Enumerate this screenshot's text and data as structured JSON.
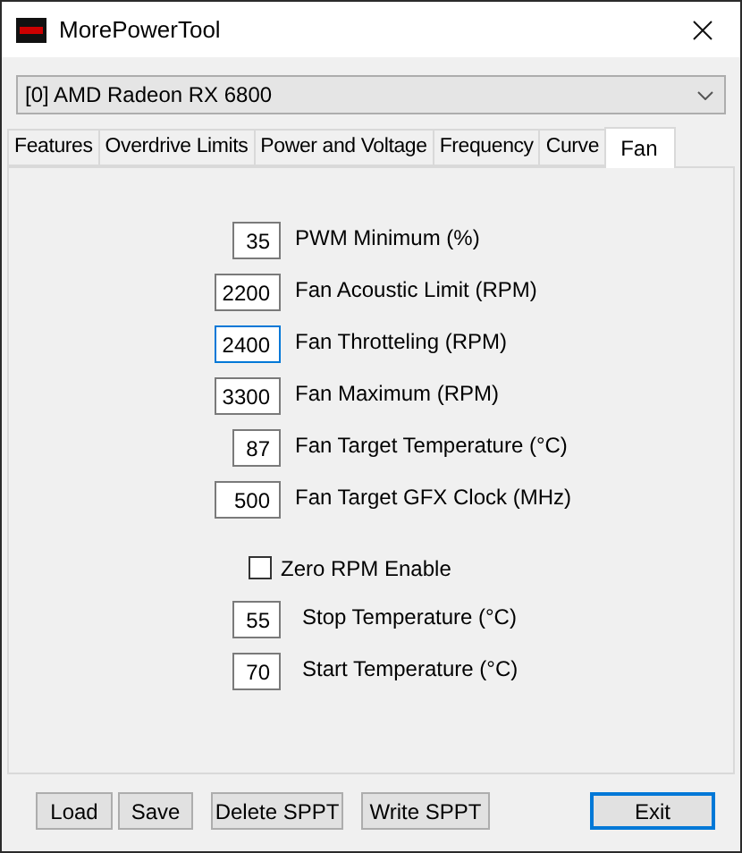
{
  "window": {
    "title": "MorePowerTool"
  },
  "device_select": {
    "value": "[0] AMD Radeon RX 6800"
  },
  "tabs": [
    {
      "label": "Features",
      "selected": false
    },
    {
      "label": "Overdrive Limits",
      "selected": false
    },
    {
      "label": "Power and Voltage",
      "selected": false
    },
    {
      "label": "Frequency",
      "selected": false
    },
    {
      "label": "Curve",
      "selected": false
    },
    {
      "label": "Fan",
      "selected": true
    }
  ],
  "fan_settings": [
    {
      "value": "35",
      "label": "PWM Minimum (%)",
      "focused": false,
      "wide": false
    },
    {
      "value": "2200",
      "label": "Fan Acoustic Limit (RPM)",
      "focused": false,
      "wide": true
    },
    {
      "value": "2400",
      "label": "Fan Throtteling (RPM)",
      "focused": true,
      "wide": true
    },
    {
      "value": "3300",
      "label": "Fan Maximum (RPM)",
      "focused": false,
      "wide": true
    },
    {
      "value": "87",
      "label": "Fan Target Temperature (°C)",
      "focused": false,
      "wide": false
    },
    {
      "value": "500",
      "label": "Fan Target GFX Clock (MHz)",
      "focused": false,
      "wide": true
    }
  ],
  "zero_rpm": {
    "label": "Zero RPM Enable",
    "checked": false
  },
  "zero_rpm_settings": [
    {
      "value": "55",
      "label": "Stop Temperature (°C)"
    },
    {
      "value": "70",
      "label": "Start Temperature (°C)"
    }
  ],
  "buttons": [
    {
      "label": "Load",
      "default": false
    },
    {
      "label": "Save",
      "default": false
    },
    {
      "label": "Delete SPPT",
      "default": false
    },
    {
      "label": "Write SPPT",
      "default": false
    },
    {
      "label": "Exit",
      "default": true
    }
  ]
}
